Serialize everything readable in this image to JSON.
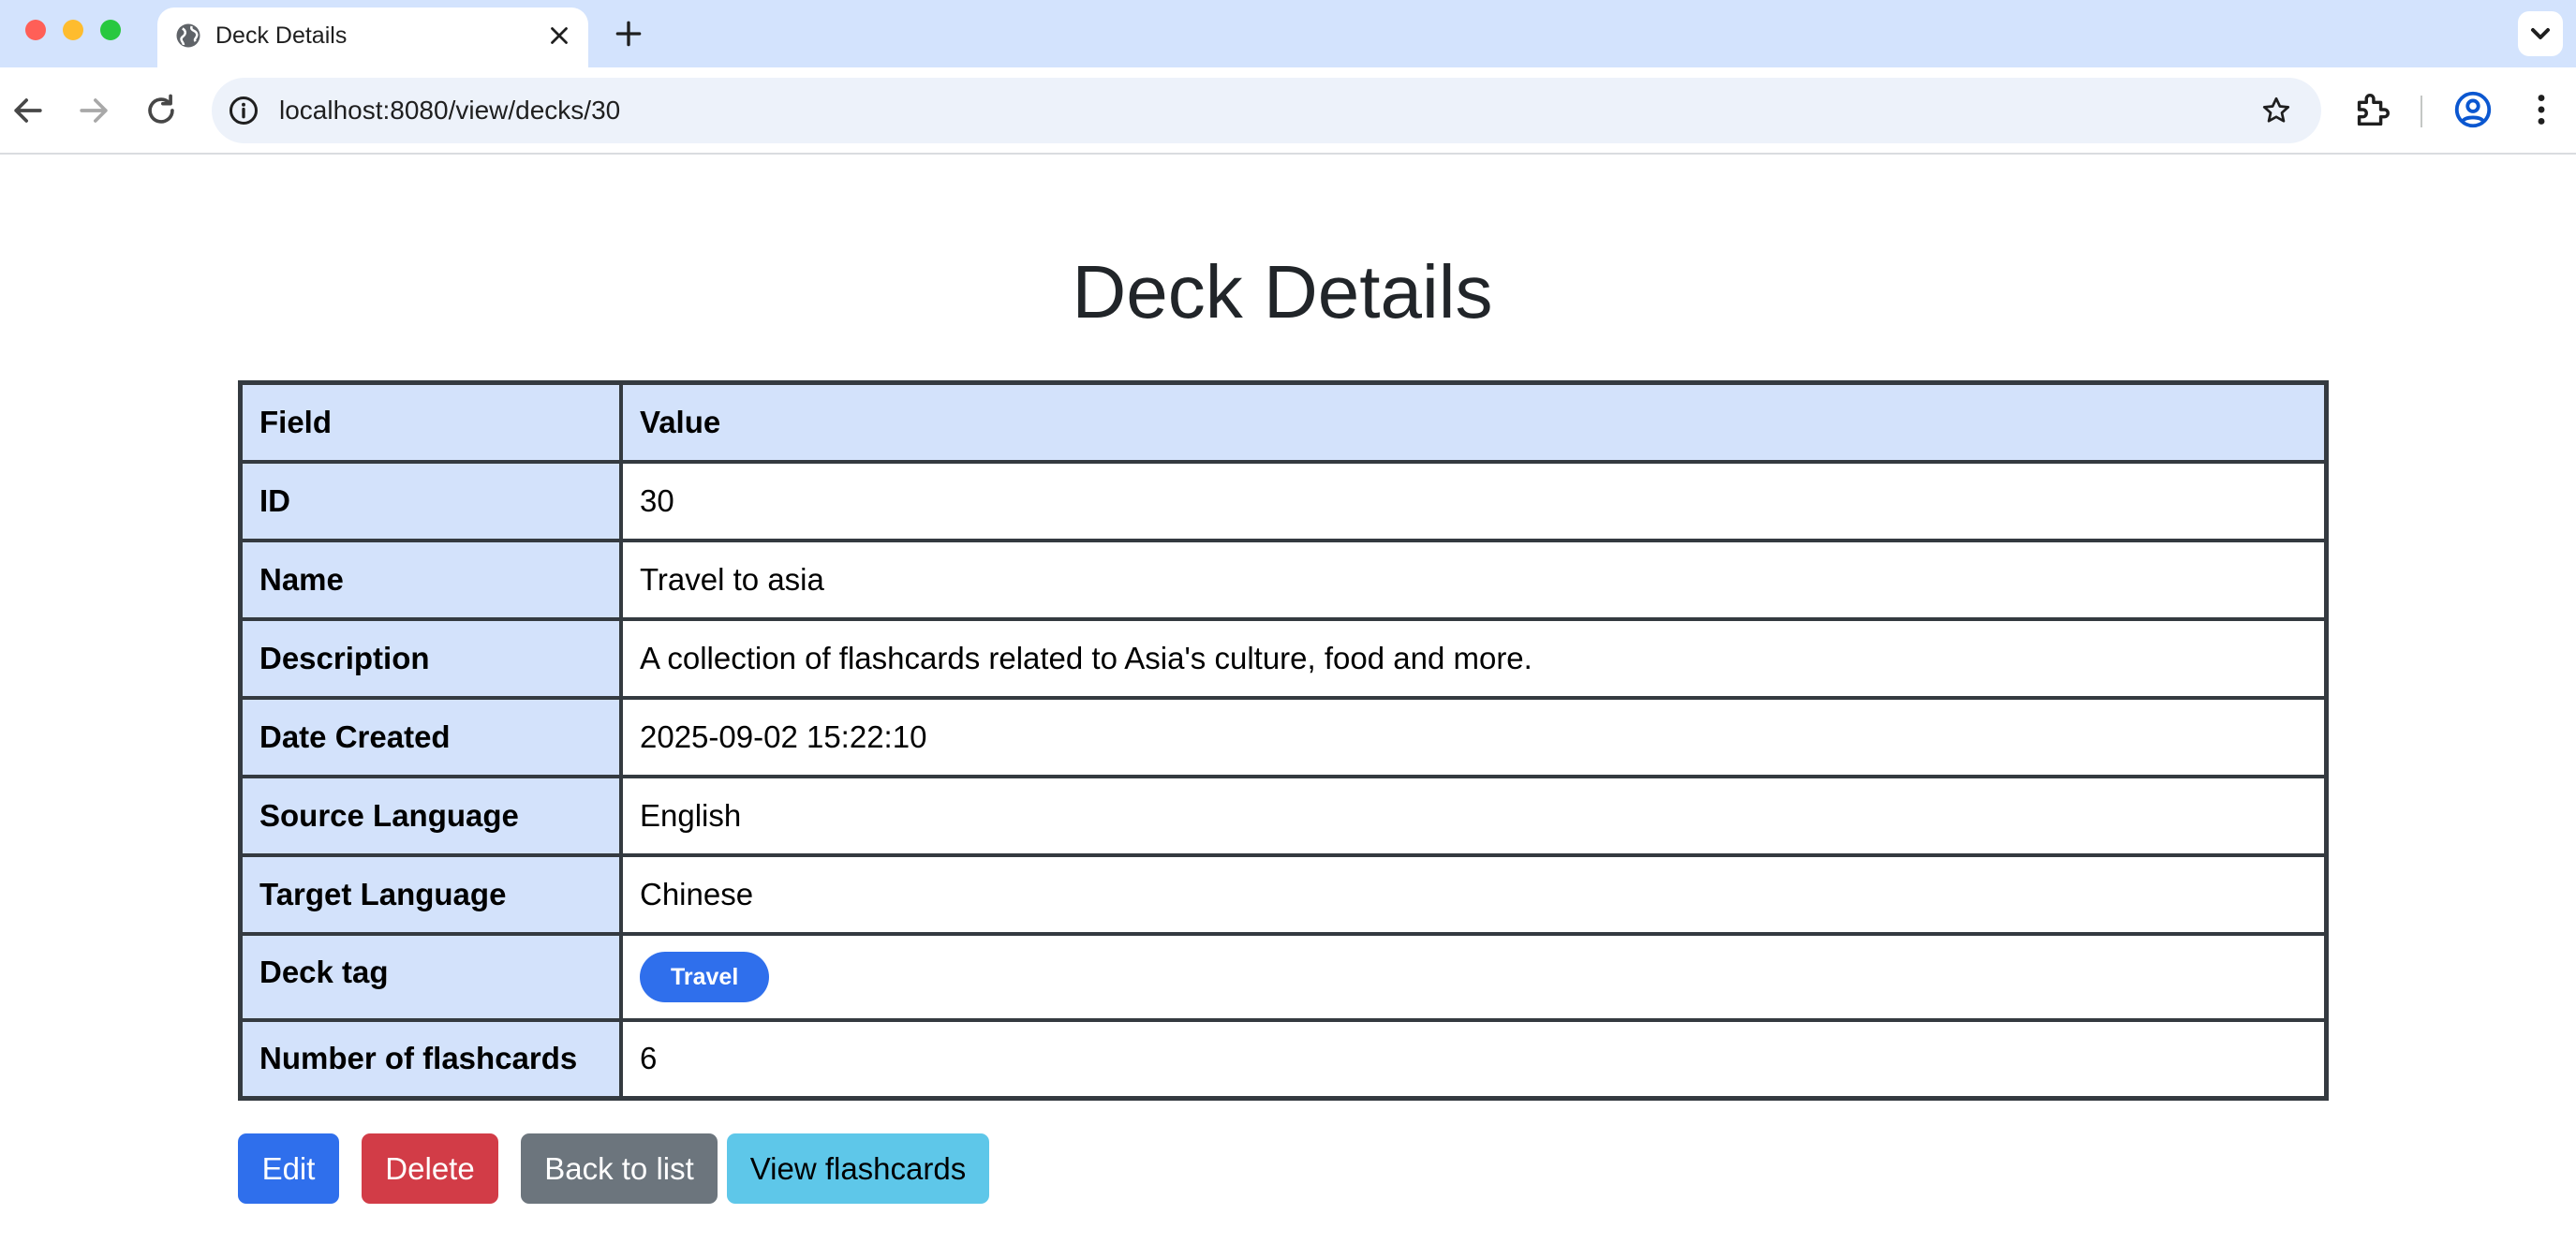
{
  "browser": {
    "tab_title": "Deck Details",
    "url": "localhost:8080/view/decks/30"
  },
  "page": {
    "title": "Deck Details"
  },
  "table": {
    "headers": {
      "field": "Field",
      "value": "Value"
    },
    "rows": [
      {
        "field": "ID",
        "value": "30"
      },
      {
        "field": "Name",
        "value": "Travel to asia"
      },
      {
        "field": "Description",
        "value": "A collection of flashcards related to Asia's culture, food and more."
      },
      {
        "field": "Date Created",
        "value": "2025-09-02 15:22:10"
      },
      {
        "field": "Source Language",
        "value": "English"
      },
      {
        "field": "Target Language",
        "value": "Chinese"
      },
      {
        "field": "Deck tag",
        "value": "Travel"
      },
      {
        "field": "Number of flashcards",
        "value": "6"
      }
    ]
  },
  "buttons": {
    "edit": "Edit",
    "delete": "Delete",
    "back": "Back to list",
    "view_flashcards": "View flashcards"
  },
  "colors": {
    "primary": "#2f6fec",
    "danger": "#d23c47",
    "secondary": "#6c757d",
    "info": "#5ec7e9",
    "table_header_bg": "#d3e2fb"
  },
  "icons": [
    "globe-icon",
    "close-icon",
    "plus-icon",
    "chevron-down-icon",
    "back-arrow-icon",
    "forward-arrow-icon",
    "reload-icon",
    "site-info-icon",
    "bookmark-star-icon",
    "extensions-icon",
    "profile-icon",
    "menu-dots-icon"
  ]
}
